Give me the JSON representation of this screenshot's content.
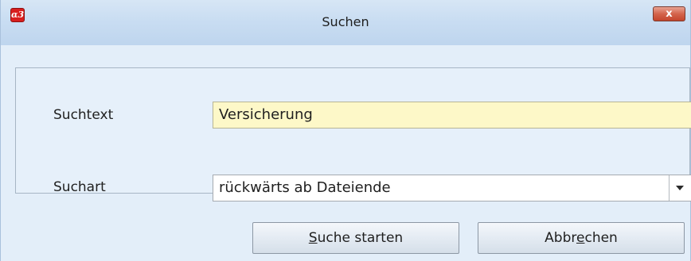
{
  "window": {
    "title": "Suchen",
    "app_icon_glyph": "α3",
    "close_glyph": "x"
  },
  "form": {
    "suchtext_label": "Suchtext",
    "suchtext_value": "Versicherung",
    "suchart_label": "Suchart",
    "suchart_value": "rückwärts ab Dateiende"
  },
  "buttons": {
    "start_pre": "",
    "start_acc": "S",
    "start_post": "uche starten",
    "cancel_pre": "Abbr",
    "cancel_acc": "e",
    "cancel_post": "chen"
  },
  "colors": {
    "window_bg": "#e3eef9",
    "input_bg": "#fdf8c8",
    "close_red": "#c4452c",
    "app_icon_red": "#d81e1e"
  }
}
